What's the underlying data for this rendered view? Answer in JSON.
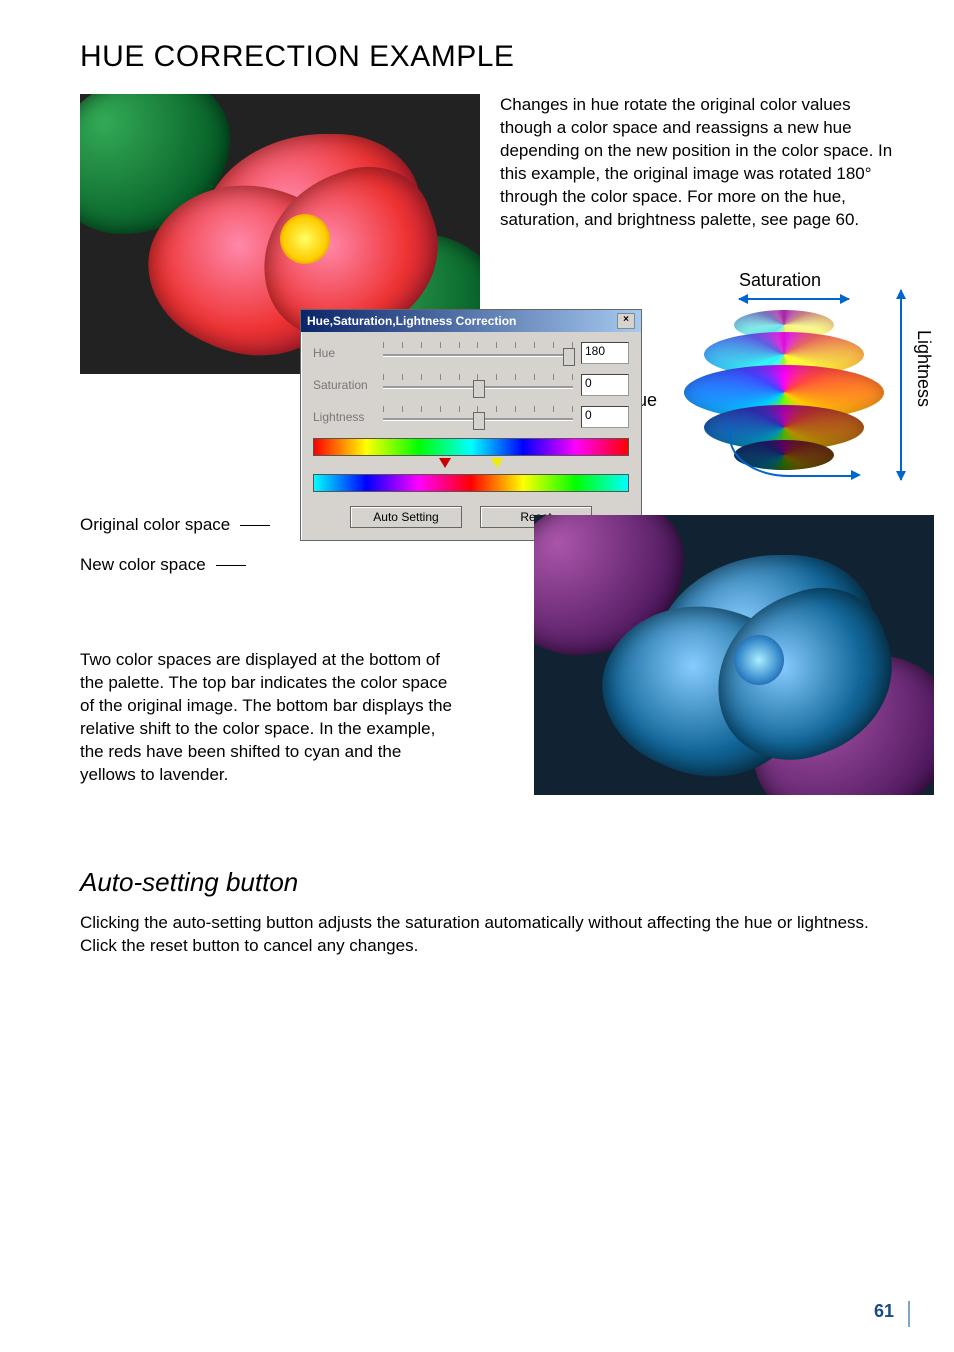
{
  "title": "HUE CORRECTION EXAMPLE",
  "intro": "Changes in hue rotate the original color values though a color space and reassigns a new hue depending on the new position in the color space. In this example, the original image was rotated 180° through the color space. For more on the hue, saturation, and brightness palette, see page 60.",
  "sphere": {
    "saturation": "Saturation",
    "lightness": "Lightness",
    "hue": "Hue"
  },
  "dialog": {
    "title": "Hue,Saturation,Lightness Correction",
    "close": "×",
    "hue_label": "Hue",
    "hue_value": "180",
    "sat_label": "Saturation",
    "sat_value": "0",
    "light_label": "Lightness",
    "light_value": "0",
    "auto_btn": "Auto Setting",
    "reset_btn": "Reset"
  },
  "left_labels": {
    "orig": "Original color space",
    "new": "New color space"
  },
  "lower_text": "Two color spaces are displayed at the bottom of the palette. The top bar indicates the color space of the original image. The bottom bar displays the relative shift to the color space. In the example, the reds have been shifted to cyan and the yellows to lavender.",
  "subhead": "Auto-setting button",
  "body2": "Clicking the auto-setting button adjusts the saturation automatically without affecting the hue or lightness. Click the reset button to cancel any changes.",
  "page_number": "61"
}
